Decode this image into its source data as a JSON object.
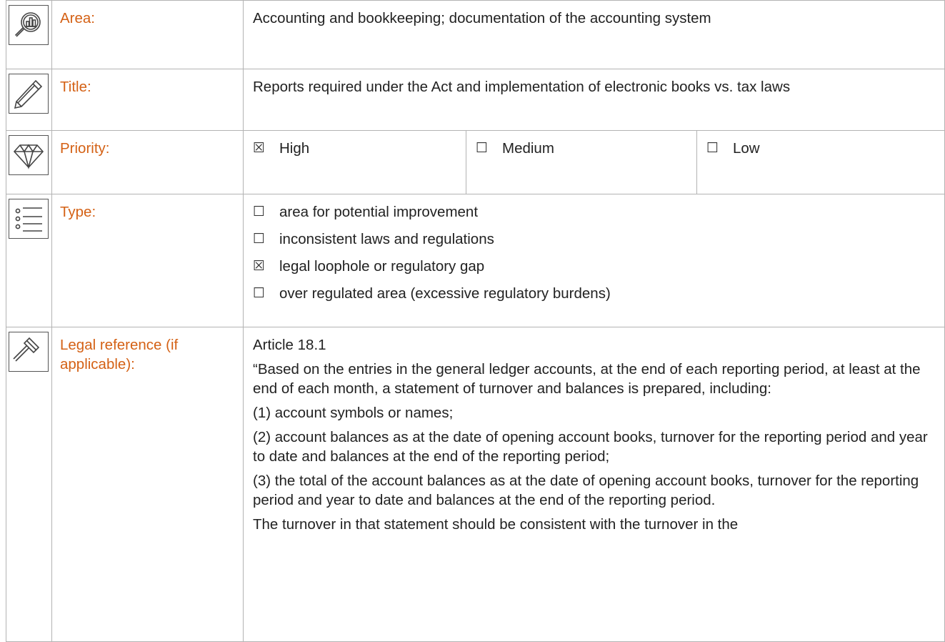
{
  "rows": {
    "area": {
      "icon": "magnifier-chart-icon",
      "label": "Area:",
      "value": "Accounting and bookkeeping; documentation of the accounting system"
    },
    "title": {
      "icon": "pencil-icon",
      "label": "Title:",
      "value": "Reports required under the Act and implementation of electronic books vs. tax laws"
    },
    "priority": {
      "icon": "diamond-icon",
      "label": "Priority:",
      "options": [
        {
          "mark": "☒",
          "text": "High",
          "checked": true
        },
        {
          "mark": "☐",
          "text": "Medium",
          "checked": false
        },
        {
          "mark": "☐",
          "text": "Low",
          "checked": false
        }
      ]
    },
    "type": {
      "icon": "list-icon",
      "label": "Type:",
      "options": [
        {
          "mark": "☐",
          "text": "area for potential improvement",
          "checked": false
        },
        {
          "mark": "☐",
          "text": "inconsistent laws and regulations",
          "checked": false
        },
        {
          "mark": "☒",
          "text": "legal loophole or regulatory gap",
          "checked": true
        },
        {
          "mark": "☐",
          "text": "over regulated area (excessive regulatory burdens)",
          "checked": false
        }
      ]
    },
    "legal": {
      "icon": "gavel-icon",
      "label": "Legal reference (if applicable):",
      "paragraphs": [
        "Article 18.1",
        "“Based on the entries in the general ledger accounts, at the end of each reporting period, at least at the end of each month, a statement of turnover and balances is prepared, including:",
        "(1) account symbols or names;",
        "(2) account balances as at the date of opening account books, turnover for the reporting period and year to date and balances at the end of the reporting period;",
        "(3) the total of the account balances as at the date of opening account books, turnover for the reporting period and year to date and balances at the end of the reporting period.",
        "The turnover in that statement should be consistent with the turnover in the"
      ]
    }
  },
  "colors": {
    "label": "#d46115",
    "border": "#b3b3b3",
    "text": "#222222"
  }
}
